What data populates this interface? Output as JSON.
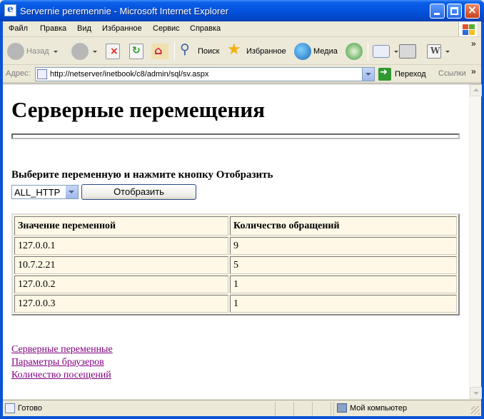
{
  "window": {
    "title": "Servernie peremennie - Microsoft Internet Explorer"
  },
  "menu": [
    "Файл",
    "Правка",
    "Вид",
    "Избранное",
    "Сервис",
    "Справка"
  ],
  "toolbar": {
    "back": "Назад",
    "search": "Поиск",
    "favorites": "Избранное",
    "media": "Медиа",
    "chevron": "»"
  },
  "address": {
    "label": "Адрес:",
    "url": "http://netserver/inetbook/c8/admin/sql/sv.aspx",
    "go": "Переход",
    "links": "Ссылки",
    "chevron": "»"
  },
  "page": {
    "heading": "Серверные перемещения",
    "prompt": "Выберите переменную и нажмите кнопку Отобразить",
    "select_value": "ALL_HTTP",
    "button": "Отобразить",
    "table": {
      "headers": [
        "Значение переменной",
        "Количество обращений"
      ],
      "rows": [
        [
          "127.0.0.1",
          "9"
        ],
        [
          "10.7.2.21",
          "5"
        ],
        [
          "127.0.0.2",
          "1"
        ],
        [
          "127.0.0.3",
          "1"
        ]
      ]
    },
    "links": [
      "Серверные переменные",
      "Параметры браузеров",
      "Количество посещений"
    ]
  },
  "status": {
    "text": "Готово",
    "zone": "Мой компьютер"
  }
}
